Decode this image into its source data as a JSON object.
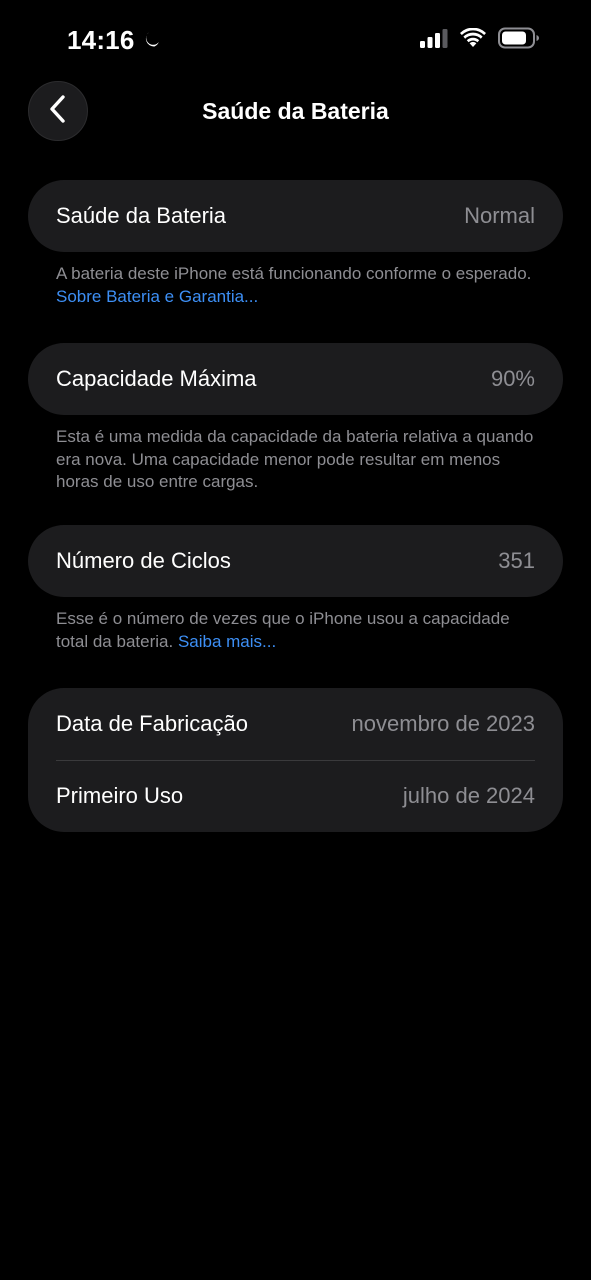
{
  "status_bar": {
    "time": "14:16",
    "icons": [
      "moon-icon",
      "cellular-signal-icon",
      "wifi-icon",
      "battery-icon"
    ]
  },
  "nav": {
    "back_icon": "chevron-left-icon",
    "title": "Saúde da Bateria"
  },
  "sections": {
    "health": {
      "label": "Saúde da Bateria",
      "value": "Normal",
      "footnote": "A bateria deste iPhone está funcionando conforme o esperado.",
      "link": "Sobre Bateria e Garantia..."
    },
    "capacity": {
      "label": "Capacidade Máxima",
      "value": "90%",
      "footnote": "Esta é uma medida da capacidade da bateria relativa a quando era nova. Uma capacidade menor pode resultar em menos horas de uso entre cargas."
    },
    "cycles": {
      "label": "Número de Ciclos",
      "value": "351",
      "footnote": "Esse é o número de vezes que o iPhone usou a capacidade total da bateria.",
      "link": "Saiba mais..."
    },
    "dates": {
      "manufacture_label": "Data de Fabricação",
      "manufacture_value": "novembro de 2023",
      "first_use_label": "Primeiro Uso",
      "first_use_value": "julho de 2024"
    }
  },
  "colors": {
    "background": "#000000",
    "card": "#1c1c1e",
    "secondary_text": "#8e8e93",
    "link": "#3d8ff5"
  }
}
